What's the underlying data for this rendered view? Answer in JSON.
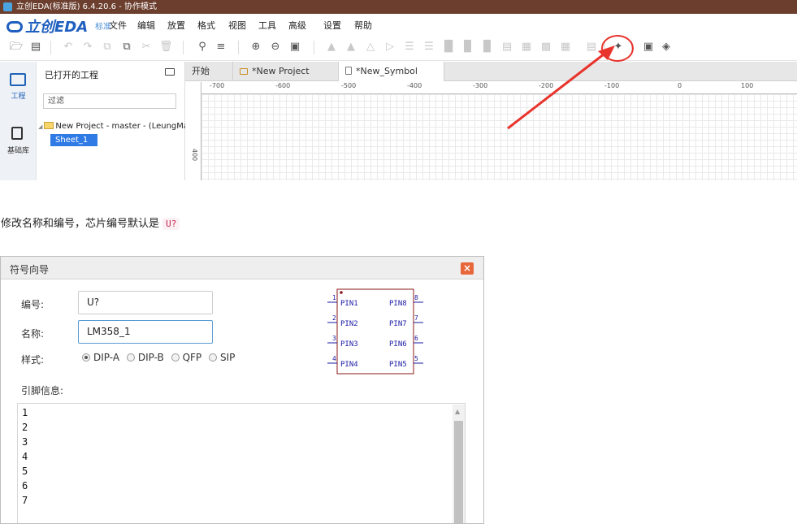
{
  "window": {
    "title": "立创EDA(标准版) 6.4.20.6 - 协作模式"
  },
  "menubar": {
    "logo": "立创EDA",
    "edition": "标准",
    "items": [
      "文件",
      "编辑",
      "放置",
      "格式",
      "视图",
      "工具",
      "高级",
      "设置",
      "帮助"
    ]
  },
  "leftbar": {
    "project_label": "工程",
    "library_label": "基础库"
  },
  "project_panel": {
    "title": "已打开的工程",
    "filter_placeholder": "过滤",
    "project_item": "New Project - master - (LeungMan",
    "sheet_item": "Sheet_1"
  },
  "tabs": [
    {
      "label": "开始",
      "icon": "none"
    },
    {
      "label": "*New Project",
      "icon": "folder-icon"
    },
    {
      "label": "*New_Symbol",
      "icon": "symbol-icon"
    }
  ],
  "ruler": {
    "top_labels": [
      "-700",
      "-600",
      "-500",
      "-400",
      "-300",
      "-200",
      "-100",
      "0",
      "100"
    ],
    "side_label": "400"
  },
  "annotation": {
    "arrow_color": "#e8342c",
    "target": "symbol-wizard-icon"
  },
  "caption": {
    "text": "修改名称和编号，芯片编号默认是",
    "code": "U?"
  },
  "dialog": {
    "title": "符号向导",
    "close": "×",
    "number_label": "编号:",
    "number_value": "U?",
    "name_label": "名称:",
    "name_value": "LM358_1",
    "style_label": "样式:",
    "styles": [
      {
        "label": "DIP-A",
        "checked": true
      },
      {
        "label": "DIP-B",
        "checked": false
      },
      {
        "label": "QFP",
        "checked": false
      },
      {
        "label": "SIP",
        "checked": false
      }
    ],
    "pins_label": "引脚信息:",
    "pin_lines": [
      "1",
      "2",
      "3",
      "4",
      "5",
      "6",
      "7"
    ],
    "preview": {
      "left_pins": [
        {
          "num": "1",
          "name": "PIN1"
        },
        {
          "num": "2",
          "name": "PIN2"
        },
        {
          "num": "3",
          "name": "PIN3"
        },
        {
          "num": "4",
          "name": "PIN4"
        }
      ],
      "right_pins": [
        {
          "num": "8",
          "name": "PIN8"
        },
        {
          "num": "7",
          "name": "PIN7"
        },
        {
          "num": "6",
          "name": "PIN6"
        },
        {
          "num": "5",
          "name": "PIN5"
        }
      ],
      "body_color": "#8b1a1a",
      "pin_color": "#1a1aa6"
    }
  }
}
